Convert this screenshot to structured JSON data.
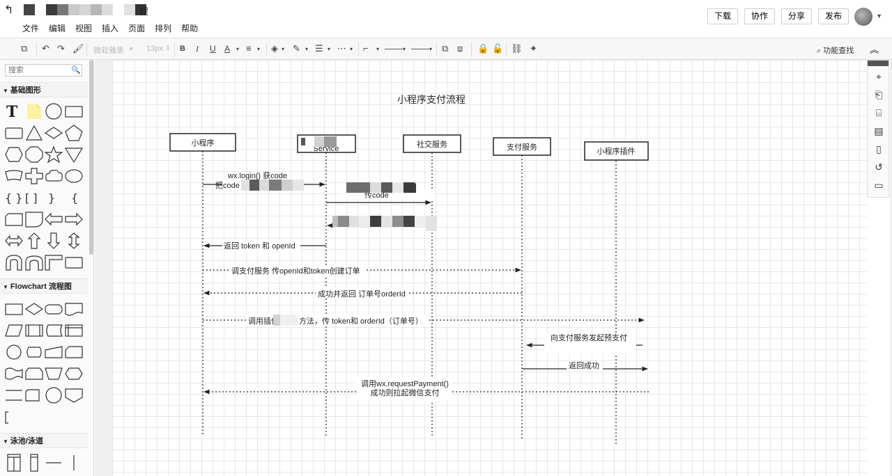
{
  "window": {
    "title_suffix": "程"
  },
  "menu": [
    "文件",
    "编辑",
    "视图",
    "插入",
    "页面",
    "排列",
    "帮助"
  ],
  "actions": {
    "download": "下载",
    "collaborate": "协作",
    "share": "分享",
    "publish": "发布"
  },
  "toolbar": {
    "font_family": "微软雅黑",
    "font_size": "13px",
    "feature_search": "功能查找"
  },
  "sidebar": {
    "search_placeholder": "搜索",
    "sections": [
      "基础图形",
      "Flowchart 流程图",
      "泳池/泳道"
    ]
  },
  "diagram": {
    "title": "小程序支付流程",
    "lifelines": [
      "小程序",
      "Service",
      "社交服务",
      "支付服务",
      "小程序插件"
    ],
    "messages": [
      "wx.login() 获code",
      "把code",
      "传code",
      "返回 token 和 openId",
      "调支付服务 传openId和token创建订单",
      "成功并返回 订单号orderId",
      "调用插件",
      "方法，传 token和 orderId（订单号）",
      "向支付服务发起预支付",
      "返回成功",
      "调用wx.requestPayment()",
      "成功则拉起微信支付"
    ]
  },
  "colors": {
    "grid": "#e7e7e7",
    "line": "#222222",
    "blur_dark": "#555555",
    "blur_mid": "#8a8a8a",
    "blur_light": "#cfcfcf"
  }
}
